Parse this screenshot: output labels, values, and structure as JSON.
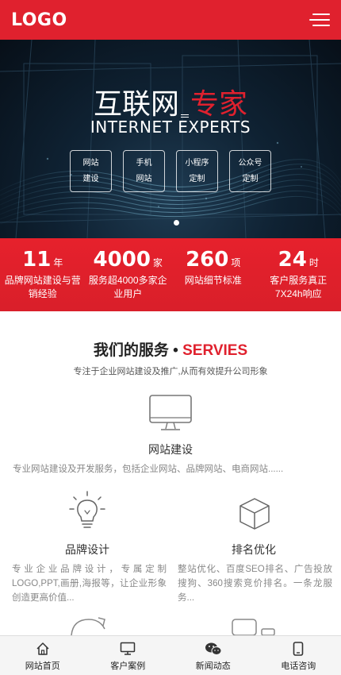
{
  "header": {
    "logo_text": "LOGO",
    "menu_icon": "hamburger-menu-icon",
    "brand_color": "#e0212e"
  },
  "banner": {
    "title_part1": "互联网",
    "title_accent": "专家",
    "subtitle": "INTERNET EXPERTS",
    "boxes": [
      {
        "line1": "网站",
        "line2": "建设"
      },
      {
        "line1": "手机",
        "line2": "网站"
      },
      {
        "line1": "小程序",
        "line2": "定制"
      },
      {
        "line1": "公众号",
        "line2": "定制"
      }
    ],
    "slide_count": 1,
    "active_slide": 1
  },
  "stats": [
    {
      "number": "11",
      "unit": "年",
      "desc": "品牌网站建设与营销经验"
    },
    {
      "number": "4000",
      "unit": "家",
      "desc": "服务超4000多家企业用户"
    },
    {
      "number": "260",
      "unit": "项",
      "desc": "网站细节标准"
    },
    {
      "number": "24",
      "unit": "时",
      "desc": "客户服务真正7X24h响应"
    }
  ],
  "services": {
    "title_cn": "我们的服务",
    "title_dot": "•",
    "title_en": "SERVIES",
    "subtitle": "专注于企业网站建设及推广,从而有效提升公司形象",
    "items": [
      {
        "name": "网站建设",
        "icon": "monitor-icon",
        "desc": "专业网站建设及开发服务，包括企业网站、品牌网站、电商网站......"
      },
      {
        "name": "品牌设计",
        "icon": "lightbulb-icon",
        "desc": "专业企业品牌设计，专属定制LOGO,PPT,画册,海报等，让企业形象创造更高价值..."
      },
      {
        "name": "排名优化",
        "icon": "cube-icon",
        "desc": "整站优化、百度SEO排名、广告投放搜狗、360搜索竞价排名。一条龙服务..."
      }
    ]
  },
  "bottom_nav": [
    {
      "label": "网站首页",
      "icon": "home-icon"
    },
    {
      "label": "客户案例",
      "icon": "monitor-icon"
    },
    {
      "label": "新闻动态",
      "icon": "wechat-icon"
    },
    {
      "label": "电话咨询",
      "icon": "phone-icon"
    }
  ]
}
